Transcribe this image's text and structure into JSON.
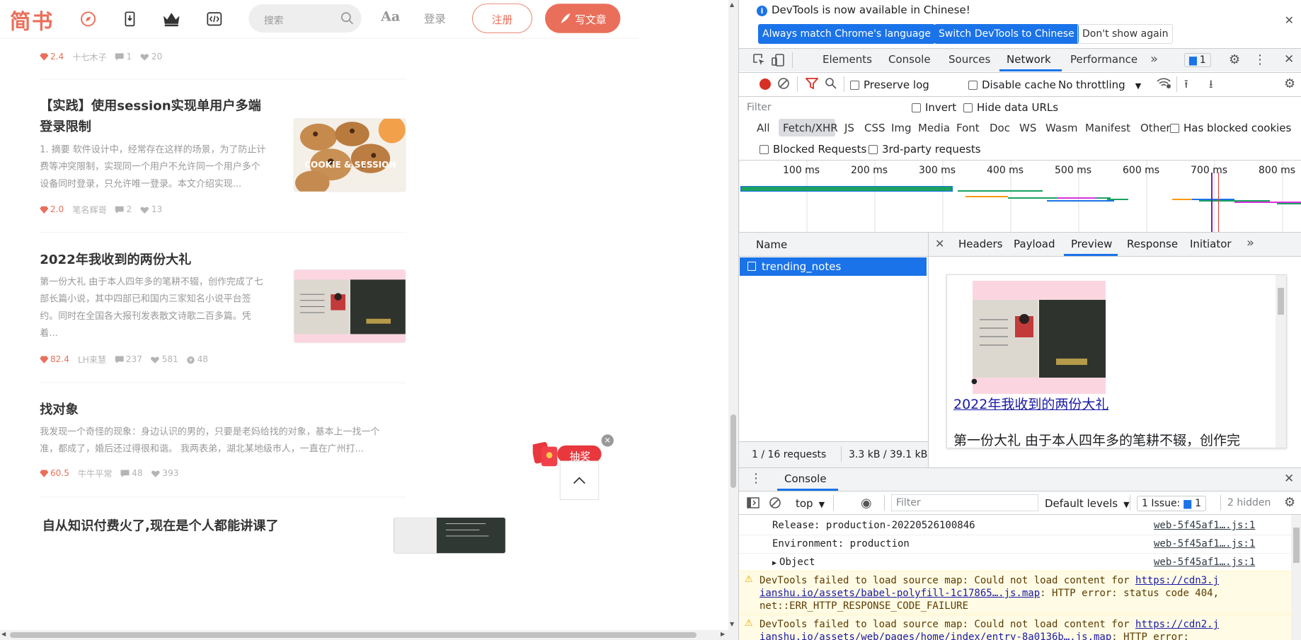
{
  "site": {
    "logo": "简书",
    "search_placeholder": "搜索",
    "font_toggle": "Aa",
    "login": "登录",
    "signup": "注册",
    "write": "写文章",
    "brand_color": "#ea6f5a"
  },
  "articles": [
    {
      "diamond": "2.4",
      "author": "十七木子",
      "comments": "1",
      "likes": "20"
    },
    {
      "title_line1": "【实践】使用session实现单用户多端",
      "title_line2": "登录限制",
      "abstract": [
        "1. 摘要 软件设计中，经常存在这样的场景，为了防止计",
        "费等冲突限制，实现同一个用户不允许同一个用户多个",
        "设备同时登录，只允许唯一登录。本文介绍实现..."
      ],
      "thumb_text": "COOKIE & SESSION",
      "diamond": "2.0",
      "author": "笔名辉哥",
      "comments": "2",
      "likes": "13"
    },
    {
      "title": "2022年我收到的两份大礼",
      "abstract": [
        "第一份大礼 由于本人四年多的笔耕不辍，创作完成了七",
        "部长篇小说，其中四部已和国内三家知名小说平台签",
        "约。同时在全国各大报刊发表散文诗歌二百多篇。凭",
        "着..."
      ],
      "diamond": "82.4",
      "author": "LH来慧",
      "comments": "237",
      "likes": "581",
      "rewards": "48"
    },
    {
      "title": "找对象",
      "abstract": [
        "我发现一个奇怪的现象：身边认识的男的，只要是老妈给找的对象，基本上一找一个",
        "准，都成了，婚后还过得很和谐。 我两表弟，湖北某地级市人，一直在广州打..."
      ],
      "diamond": "60.5",
      "author": "牛牛平常",
      "comments": "48",
      "likes": "393"
    },
    {
      "title": "自从知识付费火了,现在是个人都能讲课了"
    }
  ],
  "reward_badge": "抽奖",
  "devtools": {
    "banner": "DevTools is now available in Chinese!",
    "btn_match": "Always match Chrome's language",
    "btn_switch": "Switch DevTools to Chinese",
    "btn_dont": "Don't show again",
    "tabs": [
      "Elements",
      "Console",
      "Sources",
      "Network",
      "Performance"
    ],
    "issues_count": "1",
    "preserve_log": "Preserve log",
    "disable_cache": "Disable cache",
    "throttling": "No throttling",
    "filter_placeholder": "Filter",
    "invert": "Invert",
    "hide_data_urls": "Hide data URLs",
    "filter_types": [
      "All",
      "Fetch/XHR",
      "JS",
      "CSS",
      "Img",
      "Media",
      "Font",
      "Doc",
      "WS",
      "Wasm",
      "Manifest",
      "Other"
    ],
    "has_blocked_cookies": "Has blocked cookies",
    "blocked_requests": "Blocked Requests",
    "third_party": "3rd-party requests",
    "timeline_ticks": [
      "100 ms",
      "200 ms",
      "300 ms",
      "400 ms",
      "500 ms",
      "600 ms",
      "700 ms",
      "800 ms"
    ],
    "name_header": "Name",
    "request_name": "trending_notes",
    "detail_tabs": [
      "Headers",
      "Payload",
      "Preview",
      "Response",
      "Initiator"
    ],
    "preview_link": "2022年我收到的两份大礼",
    "preview_text": "第一份大礼 由于本人四年多的笔耕不辍，创作完",
    "status_requests": "1 / 16 requests",
    "status_size": "3.3 kB / 39.1 kB",
    "console_title": "Console",
    "console_context": "top",
    "console_filter": "Filter",
    "default_levels": "Default levels",
    "console_issues": "1 Issue:",
    "console_issues_count": "1",
    "hidden": "2 hidden",
    "console_lines": [
      {
        "text": "Release: production-20220526100846",
        "src": "web-5f45af1….js:1"
      },
      {
        "text": "Environment: production",
        "src": "web-5f45af1….js:1"
      },
      {
        "text": "Object",
        "src": "web-5f45af1….js:1"
      }
    ],
    "warn1_pre": "DevTools failed to load source map: Could not load content for ",
    "warn1_link_a": "https://cdn3.j",
    "warn1_link_b": "ianshu.io/assets/babel-polyfill-1c17865….js.map",
    "warn1_post": ": HTTP error: status code 404,",
    "warn1_line3": "net::ERR_HTTP_RESPONSE_CODE_FAILURE",
    "warn2_pre": "DevTools failed to load source map: Could not load content for ",
    "warn2_link_a": "https://cdn2.j",
    "warn2_link_b": "ianshu.io/assets/web/pages/home/index/entry-8a0136b….js.map",
    "warn2_post": ": HTTP error:"
  }
}
